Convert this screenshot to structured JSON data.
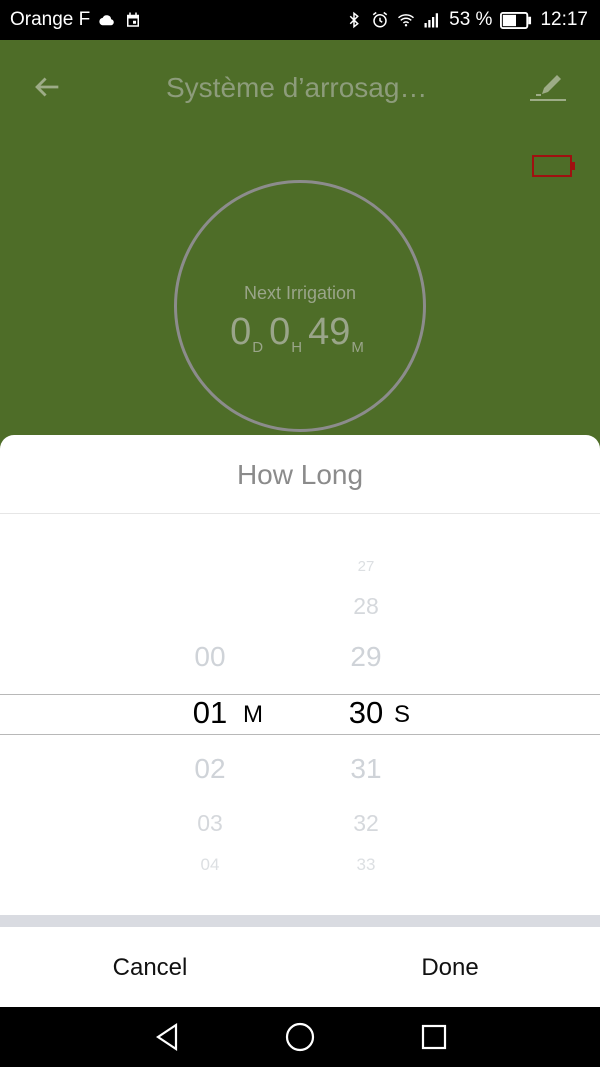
{
  "status_bar": {
    "carrier": "Orange F",
    "battery_percent": "53 %",
    "time": "12:17",
    "icons_left": [
      "cloud-icon",
      "calendar-icon"
    ],
    "icons_right": [
      "bluetooth-icon",
      "alarm-icon",
      "wifi-icon",
      "signal-icon",
      "battery-icon"
    ]
  },
  "app_bar": {
    "title": "Système d’arrosag…",
    "icons": [
      "back-arrow-icon",
      "edit-pencil-icon"
    ],
    "accent_color": "#4e6d28"
  },
  "device": {
    "battery_status_icon": "low-battery-icon",
    "warning_color": "#a01010"
  },
  "next_irrigation": {
    "label": "Next Irrigation",
    "days": "0",
    "days_unit": "D",
    "hours": "0",
    "hours_unit": "H",
    "minutes": "49",
    "minutes_unit": "M"
  },
  "sheet": {
    "title": "How Long",
    "minutes_column": {
      "selected": "01",
      "unit": "M",
      "above": [
        "00"
      ],
      "below": [
        "02",
        "03",
        "04"
      ]
    },
    "seconds_column": {
      "selected": "30",
      "unit": "S",
      "above": [
        "27",
        "28",
        "29"
      ],
      "below": [
        "31",
        "32",
        "33"
      ]
    },
    "cancel_label": "Cancel",
    "done_label": "Done"
  },
  "nav_bar": {
    "icons": [
      "back-triangle-icon",
      "home-circle-icon",
      "recents-square-icon"
    ]
  }
}
